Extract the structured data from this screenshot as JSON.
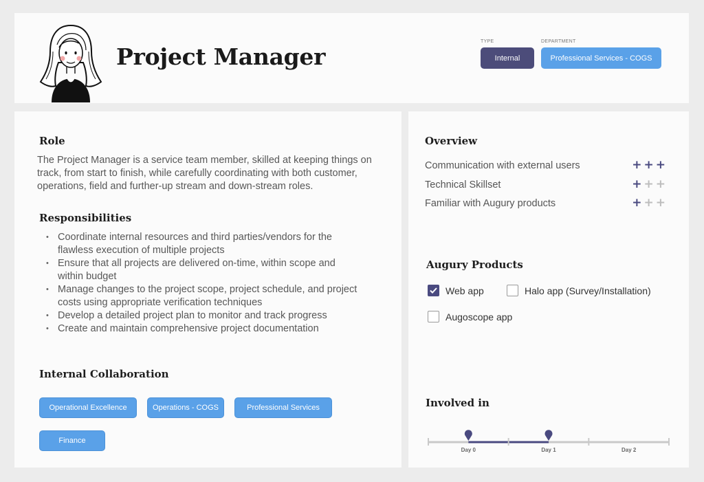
{
  "header": {
    "title": "Project Manager",
    "type_caption": "TYPE",
    "type_value": "Internal",
    "department_caption": "DEPARTMENT",
    "department_value": "Professional Services - COGS"
  },
  "role": {
    "title": "Role",
    "text": "The Project Manager is a service team member, skilled at keeping things on track, from start to finish, while carefully coordinating with both customer, operations, field and further-up stream and down-stream roles."
  },
  "responsibilities": {
    "title": "Responsibilities",
    "items": [
      "Coordinate internal resources and third parties/vendors for the flawless execution of multiple projects",
      "Ensure that all projects are delivered on-time, within scope and within budget",
      "Manage changes to the project scope, project schedule, and project costs using appropriate verification techniques",
      "Develop a detailed project plan to monitor and track progress",
      "Create and maintain comprehensive project documentation"
    ]
  },
  "collaboration": {
    "title": "Internal Collaboration",
    "items": [
      "Operational Excellence",
      "Operations - COGS",
      "Professional Services",
      "Finance"
    ]
  },
  "overview": {
    "title": "Overview",
    "max_level": 3,
    "items": [
      {
        "label": "Communication with external users",
        "level": 3
      },
      {
        "label": "Technical Skillset",
        "level": 1
      },
      {
        "label": "Familiar with Augury products",
        "level": 1
      }
    ]
  },
  "products": {
    "title": "Augury Products",
    "items": [
      {
        "label": "Web app",
        "checked": true
      },
      {
        "label": "Halo app (Survey/Installation)",
        "checked": false
      },
      {
        "label": "Augoscope app",
        "checked": false
      }
    ]
  },
  "involved": {
    "title": "Involved in",
    "days": [
      "Day 0",
      "Day 1",
      "Day 2"
    ],
    "range": [
      0.5,
      1.5
    ]
  },
  "colors": {
    "accent_dark": "#4a4a80",
    "accent_blue": "#5aa1e8",
    "plus_inactive": "#bdbdbd"
  }
}
